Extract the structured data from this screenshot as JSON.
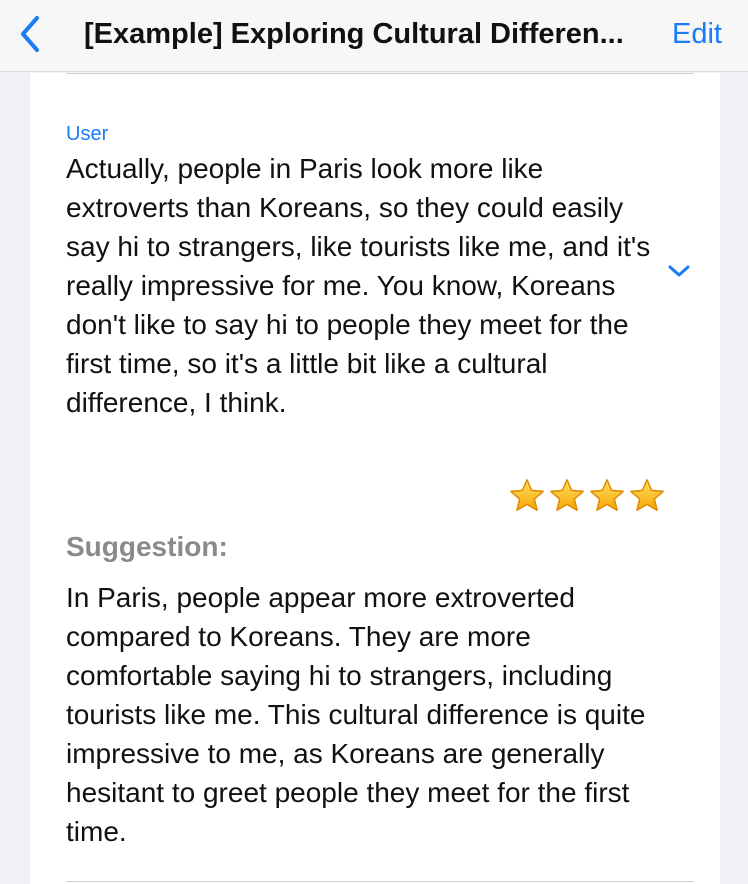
{
  "navbar": {
    "back_icon": "chevron-left-icon",
    "title": "[Example] Exploring Cultural Differen...",
    "edit_label": "Edit",
    "accent_color": "#1a7cf6"
  },
  "message": {
    "role": "User",
    "text": "Actually, people in Paris look more like extroverts than Koreans, so they could easily say hi to strangers, like tourists like me, and it's really impressive for me. You know, Koreans don't like to say hi to people they meet for the first time, so it's a little bit like a cultural difference, I think.",
    "expand_icon": "chevron-down-icon",
    "rating": 4,
    "rating_max": 4,
    "star_icon": "star-icon"
  },
  "suggestion": {
    "heading": "Suggestion:",
    "text": "In Paris, people appear more extroverted compared to Koreans. They are more comfortable saying hi to strangers, including tourists like me. This cultural difference is quite impressive to me, as Koreans are generally hesitant to greet people they meet for the first time."
  }
}
